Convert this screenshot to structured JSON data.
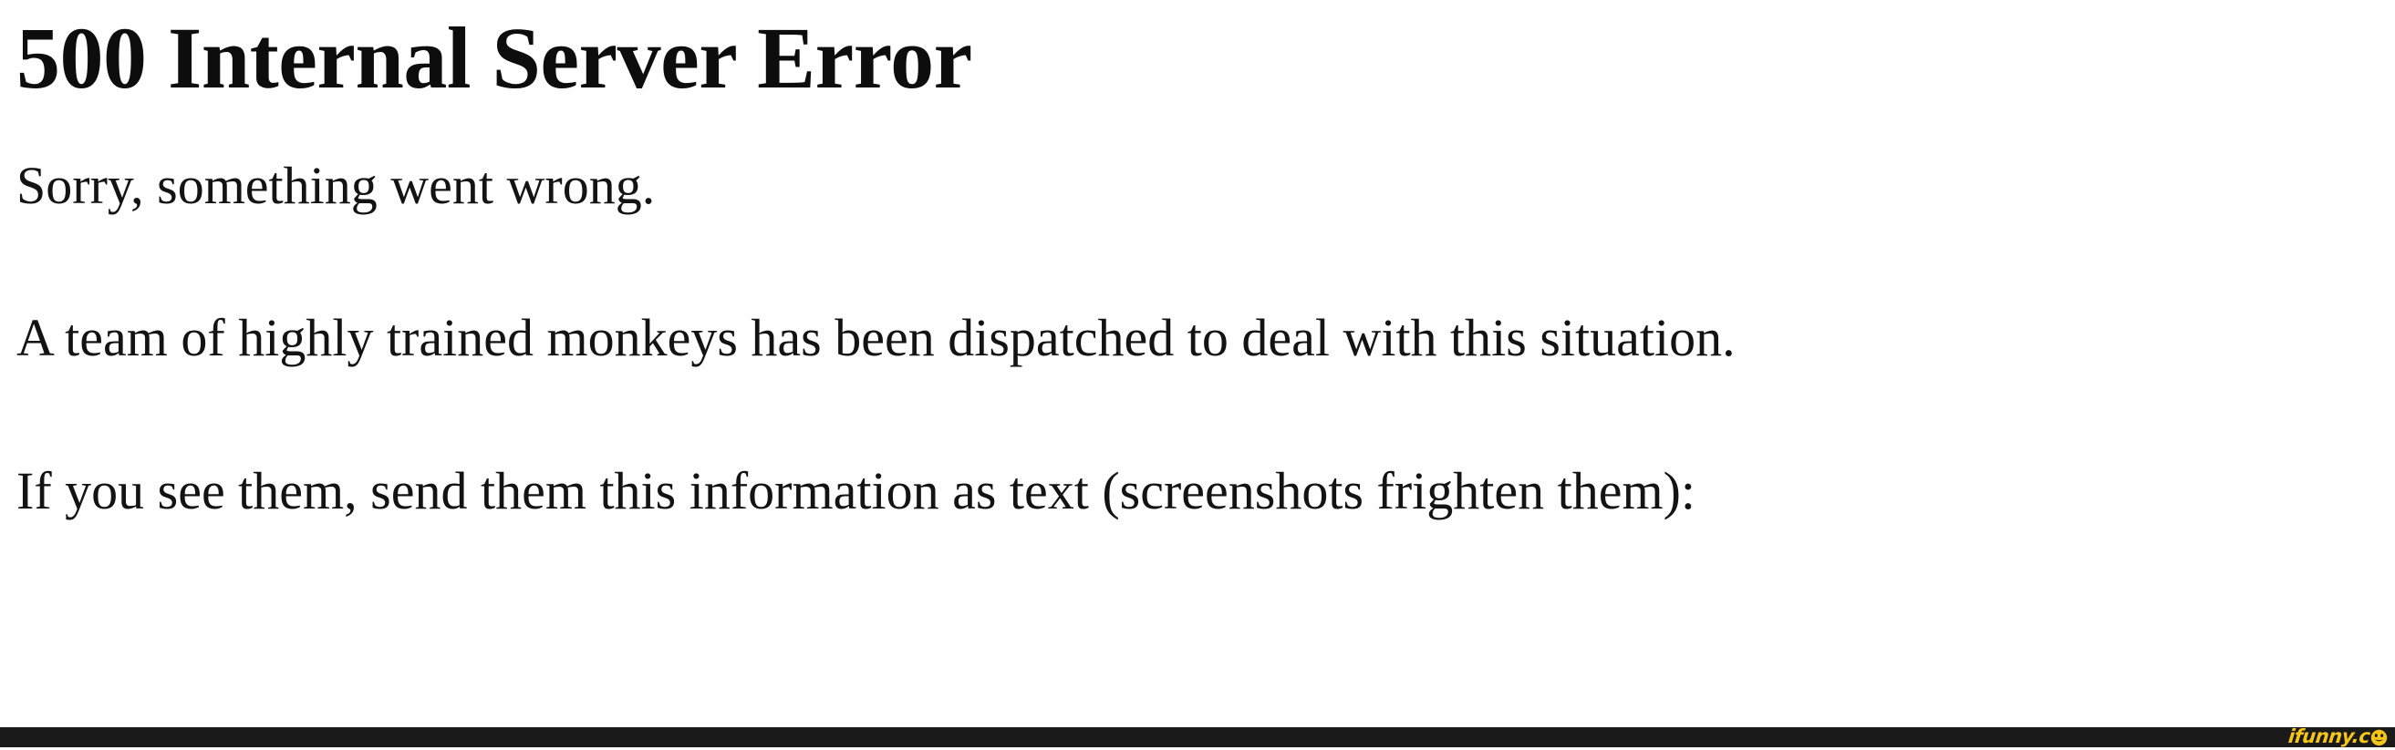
{
  "page": {
    "background_color": "#fefefe",
    "text_color": "#131313",
    "heading": "500 Internal Server Error",
    "paragraphs": [
      "Sorry, something went wrong.",
      "A team of highly trained monkeys has been dispatched to deal with this situation.",
      "If you see them, send them this information as text (screenshots frighten them):"
    ]
  },
  "watermark": {
    "bar_color": "#1a1a1a",
    "logo_color": "#f5c518",
    "text": "ifunny.c",
    "icon": "smiley-face-icon",
    "full_text": "ifunny.co"
  }
}
